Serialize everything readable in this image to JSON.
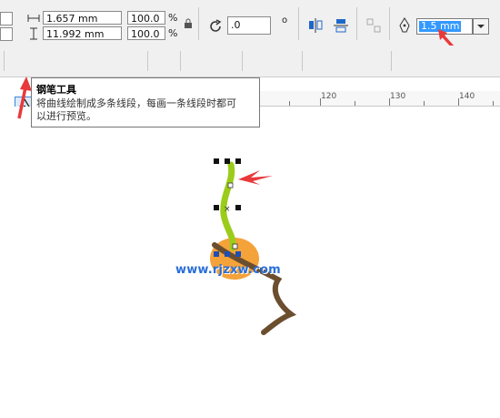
{
  "propbar": {
    "width_value": "1.657 mm",
    "height_value": "11.992 mm",
    "scale_x": "100.0",
    "scale_y": "100.0",
    "pct1": "%",
    "pct2": "%",
    "rotation_value": ".0",
    "degree_symbol": "o",
    "outline_width": "1.5 mm"
  },
  "tooltip": {
    "title": "钢笔工具",
    "line1": "将曲线绘制成多条线段，每画一条线段时都可",
    "line2": "以进行预览。"
  },
  "ruler": {
    "labels": [
      "120",
      "130",
      "140"
    ]
  },
  "watermark": "www.rjzxw.com",
  "colors": {
    "accent_red": "#e8393b",
    "stem_green": "#9ccc1a",
    "seed_orange": "#f4a23a",
    "root_brown": "#6b4e2e",
    "selection_blue": "#3399ff"
  },
  "icons": [
    "pen-icon",
    "bezier-icon",
    "rectangle-icon",
    "ellipse-icon",
    "polygon-icon",
    "text-icon",
    "line-icon",
    "connector-icon",
    "drop-shadow-icon",
    "transparency-icon",
    "eyedropper-icon",
    "fill-icon",
    "outline-pen-icon",
    "lock-icon"
  ]
}
